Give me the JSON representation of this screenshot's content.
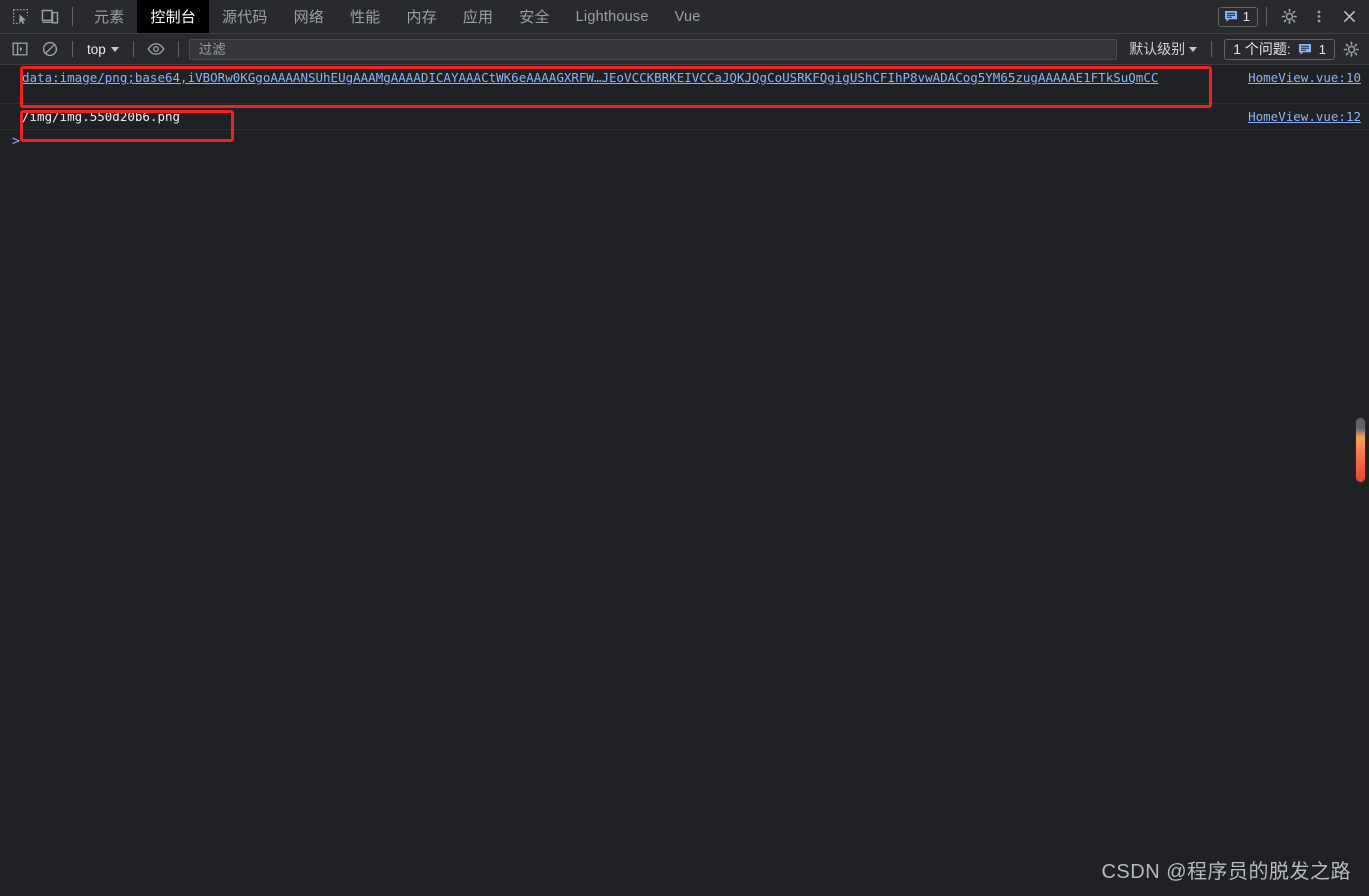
{
  "window": {
    "watermark": "CSDN @程序员的脱发之路"
  },
  "tabbar": {
    "inspect_icon": "inspect-element-icon",
    "device_icon": "device-toolbar-icon",
    "tabs": [
      {
        "label": "元素",
        "active": false,
        "latin": false
      },
      {
        "label": "控制台",
        "active": true,
        "latin": false
      },
      {
        "label": "源代码",
        "active": false,
        "latin": false
      },
      {
        "label": "网络",
        "active": false,
        "latin": false
      },
      {
        "label": "性能",
        "active": false,
        "latin": false
      },
      {
        "label": "内存",
        "active": false,
        "latin": false
      },
      {
        "label": "应用",
        "active": false,
        "latin": false
      },
      {
        "label": "安全",
        "active": false,
        "latin": false
      },
      {
        "label": "Lighthouse",
        "active": false,
        "latin": true
      },
      {
        "label": "Vue",
        "active": false,
        "latin": true
      }
    ],
    "message_count": "1",
    "settings_icon": "gear-icon",
    "more_icon": "more-vertical-icon",
    "close_icon": "close-icon"
  },
  "filterbar": {
    "sidebar_icon": "console-sidebar-icon",
    "clear_icon": "clear-console-icon",
    "context": "top",
    "eye_icon": "live-expression-eye-icon",
    "filter_value": "",
    "filter_placeholder": "过滤",
    "level": "默认级别",
    "issues_label": "1 个问题:",
    "issues_count": "1",
    "settings_icon": "console-settings-gear-icon"
  },
  "console": {
    "messages": [
      {
        "text": "data:image/png;base64,iVBORw0KGgoAAAANSUhEUgAAAMgAAAADICAYAAACtWK6eAAAAGXRFW…JEoVCCKBRKEIVCCaJQKJQgCoUSRKFQgigUShCFIhP8vwADACog5YM65zugAAAAAE1FTkSuQmCC",
        "source": "HomeView.vue:10"
      },
      {
        "text": "/img/img.550d20b6.png",
        "source": "HomeView.vue:12"
      }
    ],
    "prompt_symbol": ">"
  },
  "colors": {
    "accent_link": "#8ab4f8",
    "annotation_red": "#ef2121",
    "background": "#202124",
    "toolbar": "#292a2d"
  }
}
